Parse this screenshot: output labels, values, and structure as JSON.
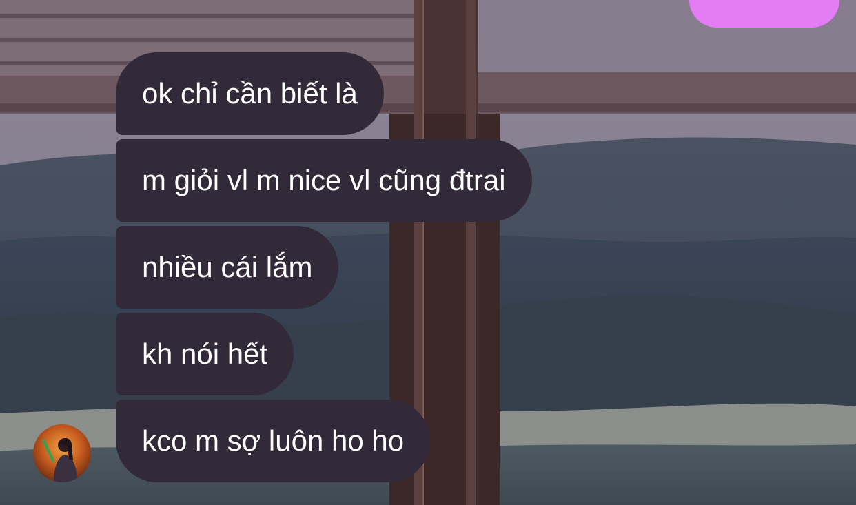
{
  "colors": {
    "received_bubble": "#332a39",
    "sent_bubble": "#e47cf6",
    "message_text": "#ffffff"
  },
  "messages": [
    {
      "text": "ok chỉ cần biết là"
    },
    {
      "text": "m giỏi vl m nice vl cũng đtrai"
    },
    {
      "text": "nhiều cái lắm"
    },
    {
      "text": "kh nói hết"
    },
    {
      "text": "kco m sợ luôn ho ho"
    }
  ]
}
